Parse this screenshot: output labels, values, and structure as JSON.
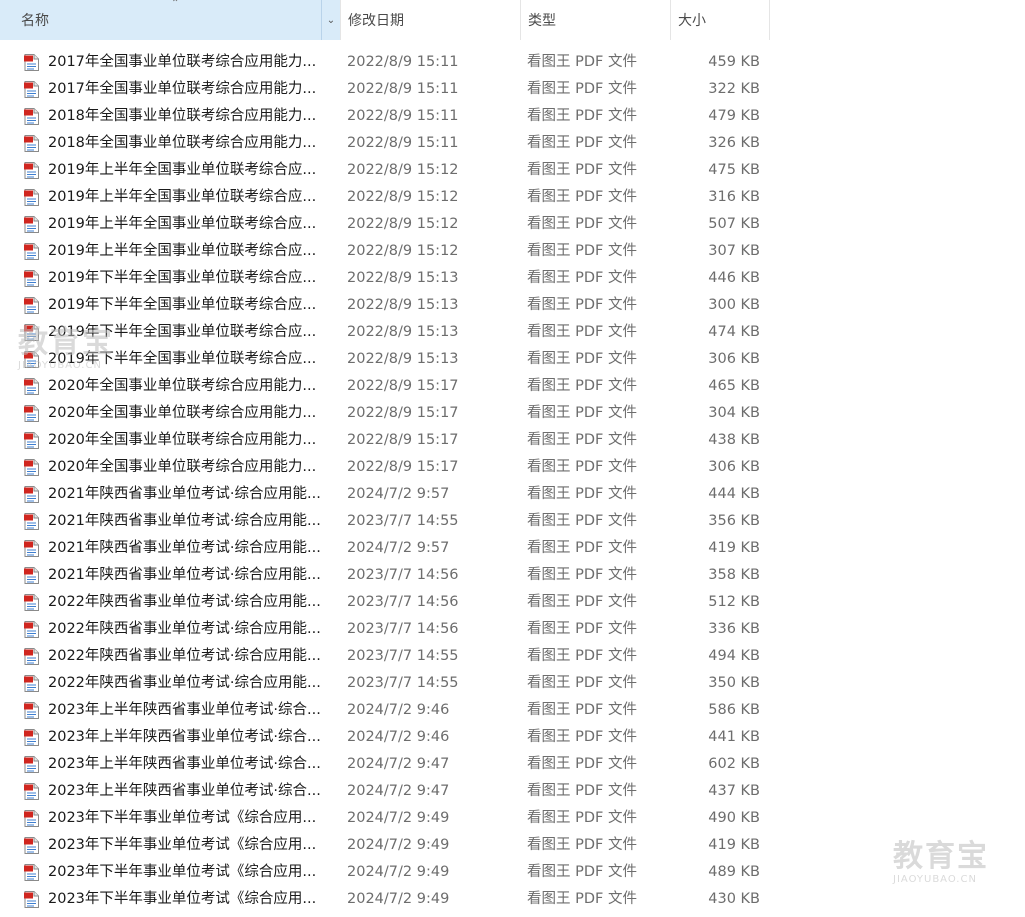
{
  "columns": {
    "name": "名称",
    "date": "修改日期",
    "type": "类型",
    "size": "大小"
  },
  "sort_icon": "chevron-up-icon",
  "file_icon": "pdf-file-icon",
  "watermark": {
    "big": "教育宝",
    "small": "JIAOYUBAO.CN"
  },
  "files": [
    {
      "name": "2017年全国事业单位联考综合应用能力...",
      "date": "2022/8/9 15:11",
      "type": "看图王 PDF 文件",
      "size": "459 KB"
    },
    {
      "name": "2017年全国事业单位联考综合应用能力...",
      "date": "2022/8/9 15:11",
      "type": "看图王 PDF 文件",
      "size": "322 KB"
    },
    {
      "name": "2018年全国事业单位联考综合应用能力...",
      "date": "2022/8/9 15:11",
      "type": "看图王 PDF 文件",
      "size": "479 KB"
    },
    {
      "name": "2018年全国事业单位联考综合应用能力...",
      "date": "2022/8/9 15:11",
      "type": "看图王 PDF 文件",
      "size": "326 KB"
    },
    {
      "name": "2019年上半年全国事业单位联考综合应...",
      "date": "2022/8/9 15:12",
      "type": "看图王 PDF 文件",
      "size": "475 KB"
    },
    {
      "name": "2019年上半年全国事业单位联考综合应...",
      "date": "2022/8/9 15:12",
      "type": "看图王 PDF 文件",
      "size": "316 KB"
    },
    {
      "name": "2019年上半年全国事业单位联考综合应...",
      "date": "2022/8/9 15:12",
      "type": "看图王 PDF 文件",
      "size": "507 KB"
    },
    {
      "name": "2019年上半年全国事业单位联考综合应...",
      "date": "2022/8/9 15:12",
      "type": "看图王 PDF 文件",
      "size": "307 KB"
    },
    {
      "name": "2019年下半年全国事业单位联考综合应...",
      "date": "2022/8/9 15:13",
      "type": "看图王 PDF 文件",
      "size": "446 KB"
    },
    {
      "name": "2019年下半年全国事业单位联考综合应...",
      "date": "2022/8/9 15:13",
      "type": "看图王 PDF 文件",
      "size": "300 KB"
    },
    {
      "name": "2019年下半年全国事业单位联考综合应...",
      "date": "2022/8/9 15:13",
      "type": "看图王 PDF 文件",
      "size": "474 KB"
    },
    {
      "name": "2019年下半年全国事业单位联考综合应...",
      "date": "2022/8/9 15:13",
      "type": "看图王 PDF 文件",
      "size": "306 KB"
    },
    {
      "name": "2020年全国事业单位联考综合应用能力...",
      "date": "2022/8/9 15:17",
      "type": "看图王 PDF 文件",
      "size": "465 KB"
    },
    {
      "name": "2020年全国事业单位联考综合应用能力...",
      "date": "2022/8/9 15:17",
      "type": "看图王 PDF 文件",
      "size": "304 KB"
    },
    {
      "name": "2020年全国事业单位联考综合应用能力...",
      "date": "2022/8/9 15:17",
      "type": "看图王 PDF 文件",
      "size": "438 KB"
    },
    {
      "name": "2020年全国事业单位联考综合应用能力...",
      "date": "2022/8/9 15:17",
      "type": "看图王 PDF 文件",
      "size": "306 KB"
    },
    {
      "name": "2021年陕西省事业单位考试·综合应用能...",
      "date": "2024/7/2 9:57",
      "type": "看图王 PDF 文件",
      "size": "444 KB"
    },
    {
      "name": "2021年陕西省事业单位考试·综合应用能...",
      "date": "2023/7/7 14:55",
      "type": "看图王 PDF 文件",
      "size": "356 KB"
    },
    {
      "name": "2021年陕西省事业单位考试·综合应用能...",
      "date": "2024/7/2 9:57",
      "type": "看图王 PDF 文件",
      "size": "419 KB"
    },
    {
      "name": "2021年陕西省事业单位考试·综合应用能...",
      "date": "2023/7/7 14:56",
      "type": "看图王 PDF 文件",
      "size": "358 KB"
    },
    {
      "name": "2022年陕西省事业单位考试·综合应用能...",
      "date": "2023/7/7 14:56",
      "type": "看图王 PDF 文件",
      "size": "512 KB"
    },
    {
      "name": "2022年陕西省事业单位考试·综合应用能...",
      "date": "2023/7/7 14:56",
      "type": "看图王 PDF 文件",
      "size": "336 KB"
    },
    {
      "name": "2022年陕西省事业单位考试·综合应用能...",
      "date": "2023/7/7 14:55",
      "type": "看图王 PDF 文件",
      "size": "494 KB"
    },
    {
      "name": "2022年陕西省事业单位考试·综合应用能...",
      "date": "2023/7/7 14:55",
      "type": "看图王 PDF 文件",
      "size": "350 KB"
    },
    {
      "name": "2023年上半年陕西省事业单位考试·综合...",
      "date": "2024/7/2 9:46",
      "type": "看图王 PDF 文件",
      "size": "586 KB"
    },
    {
      "name": "2023年上半年陕西省事业单位考试·综合...",
      "date": "2024/7/2 9:46",
      "type": "看图王 PDF 文件",
      "size": "441 KB"
    },
    {
      "name": "2023年上半年陕西省事业单位考试·综合...",
      "date": "2024/7/2 9:47",
      "type": "看图王 PDF 文件",
      "size": "602 KB"
    },
    {
      "name": "2023年上半年陕西省事业单位考试·综合...",
      "date": "2024/7/2 9:47",
      "type": "看图王 PDF 文件",
      "size": "437 KB"
    },
    {
      "name": "2023年下半年事业单位考试《综合应用...",
      "date": "2024/7/2 9:49",
      "type": "看图王 PDF 文件",
      "size": "490 KB"
    },
    {
      "name": "2023年下半年事业单位考试《综合应用...",
      "date": "2024/7/2 9:49",
      "type": "看图王 PDF 文件",
      "size": "419 KB"
    },
    {
      "name": "2023年下半年事业单位考试《综合应用...",
      "date": "2024/7/2 9:49",
      "type": "看图王 PDF 文件",
      "size": "489 KB"
    },
    {
      "name": "2023年下半年事业单位考试《综合应用...",
      "date": "2024/7/2 9:49",
      "type": "看图王 PDF 文件",
      "size": "430 KB"
    }
  ]
}
